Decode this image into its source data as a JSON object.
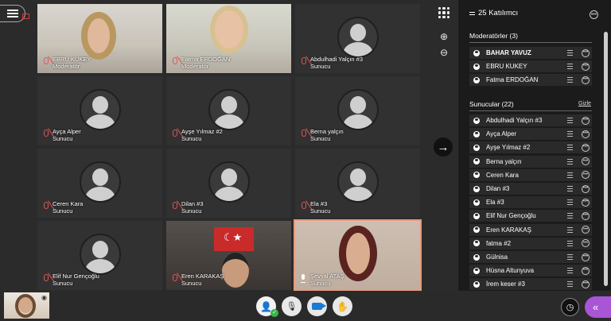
{
  "header": {
    "menu_icon": "hamburger-icon",
    "record_icon": "record-icon"
  },
  "tiles": [
    {
      "name": "EBRU KUKEY",
      "role": "Moderatör",
      "mic": "off",
      "camera": true
    },
    {
      "name": "Fatma ERDOĞAN",
      "role": "Moderatör",
      "mic": "off",
      "camera": true
    },
    {
      "name": "Abdulhadi Yalçın #3",
      "role": "Sunucu",
      "mic": "off",
      "camera": false
    },
    {
      "name": "Ayça Alper",
      "role": "Sunucu",
      "mic": "off",
      "camera": false
    },
    {
      "name": "Ayşe Yılmaz #2",
      "role": "Sunucu",
      "mic": "off",
      "camera": false
    },
    {
      "name": "Berna yalçın",
      "role": "Sunucu",
      "mic": "off",
      "camera": false
    },
    {
      "name": "Ceren Kara",
      "role": "Sunucu",
      "mic": "off",
      "camera": false
    },
    {
      "name": "Dilan #3",
      "role": "Sunucu",
      "mic": "off",
      "camera": false
    },
    {
      "name": "Ela #3",
      "role": "Sunucu",
      "mic": "off",
      "camera": false
    },
    {
      "name": "Elif Nur Gençoğlu",
      "role": "Sunucu",
      "mic": "off",
      "camera": false
    },
    {
      "name": "Eren KARAKAŞ",
      "role": "Sunucu",
      "mic": "off",
      "camera": true
    },
    {
      "name": "Şevval ATAŞ",
      "role": "Sunucu",
      "mic": "on",
      "camera": true,
      "active": true
    }
  ],
  "panel": {
    "title": "25 Katılımcı",
    "moderators_title": "Moderatörler (3)",
    "moderators": [
      "BAHAR YAVUZ",
      "EBRU KUKEY",
      "Fatma ERDOĞAN"
    ],
    "presenters_title": "Sunucular (22)",
    "hide_label": "Gizle",
    "presenters": [
      "Abdulhadi Yalçın #3",
      "Ayça Alper",
      "Ayşe Yılmaz #2",
      "Berna yalçın",
      "Ceren Kara",
      "Dilan #3",
      "Ela #3",
      "Elif Nur Gençoğlu",
      "Eren KARAKAŞ",
      "fatma #2",
      "Gülnisa",
      "Hüsna Altunyuva",
      "İrem keser #3"
    ]
  },
  "rail": {
    "grid_icon": "grid-view-icon",
    "zoom_in_icon": "zoom-in-icon",
    "zoom_out_icon": "zoom-out-icon",
    "next_icon": "arrow-right-icon"
  },
  "controls": {
    "user_icon": "user-icon",
    "mic_icon": "mic-off-icon",
    "camera_icon": "camera-icon",
    "hand_icon": "raise-hand-icon",
    "timer_icon": "timer-icon",
    "collapse_icon": "collapse-panel-icon"
  },
  "colors": {
    "accent": "#a855d6",
    "active_border": "#e89a7f",
    "mic_off": "#e05555",
    "camera": "#1a7bd4"
  }
}
